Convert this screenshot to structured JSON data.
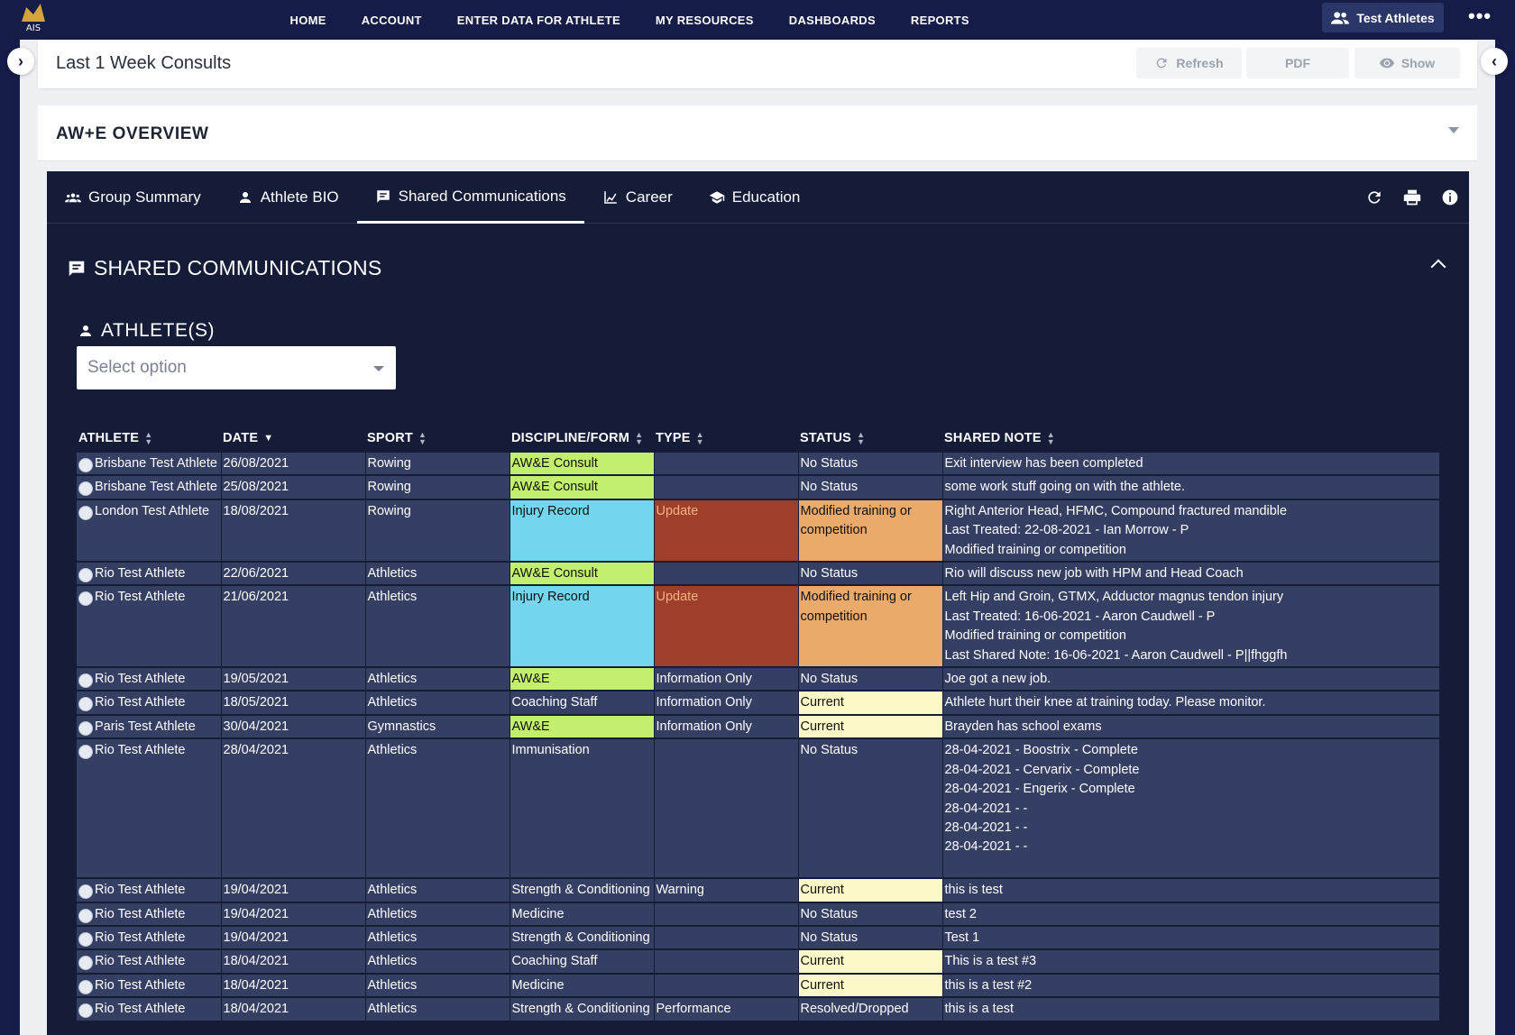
{
  "nav": {
    "logo_text": "AIS",
    "links": [
      "HOME",
      "ACCOUNT",
      "ENTER DATA FOR ATHLETE",
      "MY RESOURCES",
      "DASHBOARDS",
      "REPORTS"
    ],
    "account_button": "Test Athletes",
    "more": "•••"
  },
  "page": {
    "title": "Last 1 Week Consults",
    "refresh_label": "Refresh",
    "pdf_label": "PDF",
    "show_label": "Show"
  },
  "overview": {
    "title": "AW+E OVERVIEW"
  },
  "tabs": [
    {
      "label": "Group Summary",
      "icon": "group-icon"
    },
    {
      "label": "Athlete BIO",
      "icon": "person-icon"
    },
    {
      "label": "Shared Communications",
      "icon": "message-icon"
    },
    {
      "label": "Career",
      "icon": "chart-icon"
    },
    {
      "label": "Education",
      "icon": "school-icon"
    }
  ],
  "section": {
    "title": "SHARED COMMUNICATIONS",
    "athletes_label": "ATHLETE(S)",
    "select_placeholder": "Select option"
  },
  "table": {
    "headers": [
      "ATHLETE",
      "DATE",
      "SPORT",
      "DISCIPLINE/FORM",
      "TYPE",
      "STATUS",
      "SHARED NOTE"
    ],
    "rows": [
      {
        "athlete": "Brisbane Test Athlete",
        "date": "26/08/2021",
        "sport": "Rowing",
        "discipline": "AW&E Consult",
        "type": "",
        "status": "No Status",
        "note": [
          "Exit interview has been completed"
        ],
        "disc_color": "green",
        "type_color": "",
        "status_color": ""
      },
      {
        "athlete": "Brisbane Test Athlete",
        "date": "25/08/2021",
        "sport": "Rowing",
        "discipline": "AW&E Consult",
        "type": "",
        "status": "No Status",
        "note": [
          "some work stuff going on with the athlete."
        ],
        "disc_color": "green",
        "type_color": "",
        "status_color": ""
      },
      {
        "athlete": "London Test Athlete",
        "date": "18/08/2021",
        "sport": "Rowing",
        "discipline": "Injury Record",
        "type": "Update",
        "status": "Modified training or competition",
        "note": [
          "Right Anterior Head, HFMC, Compound fractured mandible",
          "Last Treated: 22-08-2021 - Ian Morrow - P",
          "Modified training or competition"
        ],
        "disc_color": "cyan",
        "type_color": "red",
        "status_color": "orange"
      },
      {
        "athlete": "Rio Test Athlete",
        "date": "22/06/2021",
        "sport": "Athletics",
        "discipline": "AW&E Consult",
        "type": "",
        "status": "No Status",
        "note": [
          "Rio will discuss new job with HPM and Head Coach"
        ],
        "disc_color": "green",
        "type_color": "",
        "status_color": ""
      },
      {
        "athlete": "Rio Test Athlete",
        "date": "21/06/2021",
        "sport": "Athletics",
        "discipline": "Injury Record",
        "type": "Update",
        "status": "Modified training or competition",
        "note": [
          "Left Hip and Groin, GTMX, Adductor magnus tendon injury",
          "Last Treated: 16-06-2021 - Aaron Caudwell - P",
          "Modified training or competition",
          "Last Shared Note: 16-06-2021 - Aaron Caudwell - P||fhggfh"
        ],
        "disc_color": "cyan",
        "type_color": "red",
        "status_color": "orange"
      },
      {
        "athlete": "Rio Test Athlete",
        "date": "19/05/2021",
        "sport": "Athletics",
        "discipline": "AW&E",
        "type": "Information Only",
        "status": "No Status",
        "note": [
          "Joe got a new job."
        ],
        "disc_color": "green",
        "type_color": "",
        "status_color": ""
      },
      {
        "athlete": "Rio Test Athlete",
        "date": "18/05/2021",
        "sport": "Athletics",
        "discipline": "Coaching Staff",
        "type": "Information Only",
        "status": "Current",
        "note": [
          "Athlete hurt their knee at training today. Please monitor."
        ],
        "disc_color": "",
        "type_color": "",
        "status_color": "yellow"
      },
      {
        "athlete": "Paris Test Athlete",
        "date": "30/04/2021",
        "sport": "Gymnastics",
        "discipline": "AW&E",
        "type": "Information Only",
        "status": "Current",
        "note": [
          "Brayden has school exams"
        ],
        "disc_color": "green",
        "type_color": "",
        "status_color": "yellow"
      },
      {
        "athlete": "Rio Test Athlete",
        "date": "28/04/2021",
        "sport": "Athletics",
        "discipline": "Immunisation",
        "type": "",
        "status": "No Status",
        "note": [
          "28-04-2021 - Boostrix - Complete",
          "28-04-2021 - Cervarix - Complete",
          "28-04-2021 - Engerix - Complete",
          "28-04-2021 - -",
          "28-04-2021 - -",
          "28-04-2021 - -",
          ""
        ],
        "disc_color": "",
        "type_color": "",
        "status_color": ""
      },
      {
        "athlete": "Rio Test Athlete",
        "date": "19/04/2021",
        "sport": "Athletics",
        "discipline": "Strength & Conditioning",
        "type": "Warning",
        "status": "Current",
        "note": [
          "this is test"
        ],
        "disc_color": "",
        "type_color": "",
        "status_color": "yellow"
      },
      {
        "athlete": "Rio Test Athlete",
        "date": "19/04/2021",
        "sport": "Athletics",
        "discipline": "Medicine",
        "type": "",
        "status": "No Status",
        "note": [
          "test 2"
        ],
        "disc_color": "",
        "type_color": "",
        "status_color": ""
      },
      {
        "athlete": "Rio Test Athlete",
        "date": "19/04/2021",
        "sport": "Athletics",
        "discipline": "Strength & Conditioning",
        "type": "",
        "status": "No Status",
        "note": [
          "Test 1"
        ],
        "disc_color": "",
        "type_color": "",
        "status_color": ""
      },
      {
        "athlete": "Rio Test Athlete",
        "date": "18/04/2021",
        "sport": "Athletics",
        "discipline": "Coaching Staff",
        "type": "",
        "status": "Current",
        "note": [
          "This is a test #3"
        ],
        "disc_color": "",
        "type_color": "",
        "status_color": "yellow"
      },
      {
        "athlete": "Rio Test Athlete",
        "date": "18/04/2021",
        "sport": "Athletics",
        "discipline": "Medicine",
        "type": "",
        "status": "Current",
        "note": [
          "this is a test #2"
        ],
        "disc_color": "",
        "type_color": "",
        "status_color": "yellow"
      },
      {
        "athlete": "Rio Test Athlete",
        "date": "18/04/2021",
        "sport": "Athletics",
        "discipline": "Strength & Conditioning",
        "type": "Performance",
        "status": "Resolved/Dropped",
        "note": [
          "this is a test"
        ],
        "disc_color": "",
        "type_color": "",
        "status_color": ""
      }
    ]
  },
  "colors": {
    "nav_bg": "#141c47",
    "panel_bg": "#141c38",
    "row_bg": "#343f63",
    "green": "#c3ef6e",
    "cyan": "#73d6ee",
    "red": "#9e3f2c",
    "orange": "#eaaa6b",
    "yellow": "#fbf8c7"
  }
}
